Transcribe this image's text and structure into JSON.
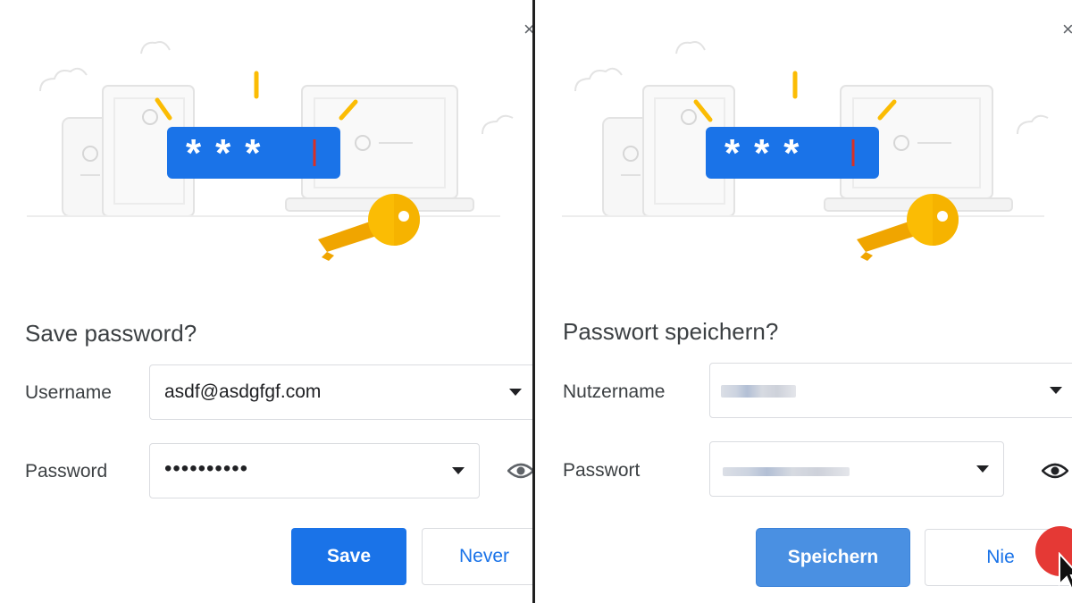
{
  "left_dialog": {
    "title": "Save password?",
    "close_glyph": "×",
    "username_label": "Username",
    "username_value": "asdf@asdgfgf.com",
    "password_label": "Password",
    "password_value": "••••••••••",
    "save_label": "Save",
    "never_label": "Never",
    "illustration_text": "***"
  },
  "right_dialog": {
    "title": "Passwort speichern?",
    "close_glyph": "×",
    "username_label": "Nutzername",
    "password_label": "Passwort",
    "save_label": "Speichern",
    "never_label": "Nie",
    "illustration_text": "***"
  },
  "colors": {
    "accent": "#1a73e8",
    "key": "#fbbc04",
    "cursor_mark": "#d93025"
  },
  "icons": [
    "close-icon",
    "chevron-down-icon",
    "eye-icon",
    "key-icon",
    "mouse-pointer-icon"
  ]
}
